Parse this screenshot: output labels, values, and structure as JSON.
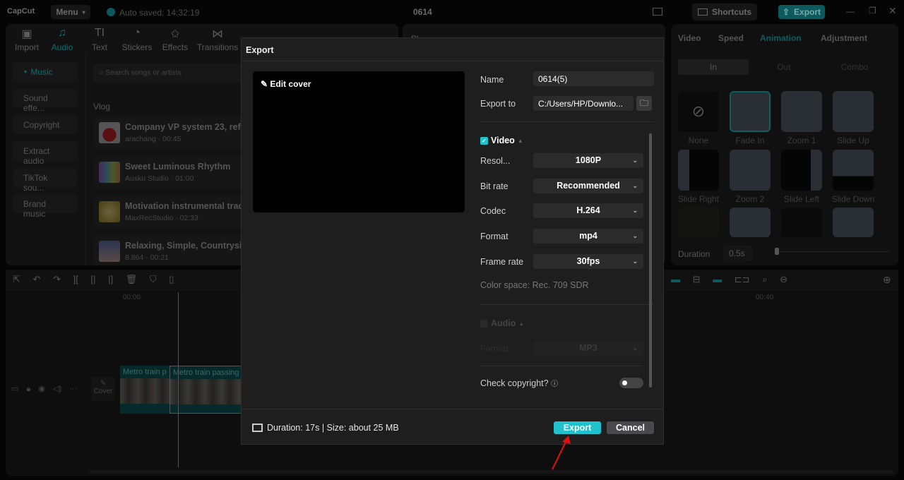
{
  "app": {
    "logo": "CapCut",
    "menu": "Menu",
    "autosave": "Auto saved: 14:32:19",
    "project_title": "0614",
    "shortcuts": "Shortcuts",
    "export": "Export"
  },
  "toolbar_tabs": [
    {
      "label": "Import",
      "icon": "import-icon"
    },
    {
      "label": "Audio",
      "icon": "audio-icon"
    },
    {
      "label": "Text",
      "icon": "text-icon"
    },
    {
      "label": "Stickers",
      "icon": "stickers-icon"
    },
    {
      "label": "Effects",
      "icon": "effects-icon"
    },
    {
      "label": "Transitions",
      "icon": "transitions-icon"
    }
  ],
  "audio_sidebar": [
    "Music",
    "Sound effe...",
    "Copyright",
    "Extract audio",
    "TikTok sou...",
    "Brand music"
  ],
  "search_placeholder": "Search songs or artists",
  "section": "Vlog",
  "songs": [
    {
      "title": "Company VP system 23, refr",
      "sub": "arachang · 00:45"
    },
    {
      "title": "Sweet Luminous Rhythm",
      "sub": "Ausku Studio · 01:00"
    },
    {
      "title": "Motivation instrumental trac",
      "sub": "MaxRecStudio · 02:33"
    },
    {
      "title": "Relaxing, Simple, Countrysid",
      "sub": "8.864 · 00:21"
    }
  ],
  "player_label": "Pl",
  "right_tabs": [
    "Video",
    "Speed",
    "Animation",
    "Adjustment"
  ],
  "anim_tabs": [
    "In",
    "Out",
    "Combo"
  ],
  "animations": [
    "None",
    "Fade In",
    "Zoom 1",
    "Slide Up",
    "Slide Right",
    "Zoom 2",
    "Slide Left",
    "Slide Down"
  ],
  "duration": {
    "label": "Duration",
    "value": "0.5s"
  },
  "timeline": {
    "t0": "00:00",
    "t40": "00:40",
    "cover": "Cover",
    "clip1": "Metro train p",
    "clip2": "Metro train passing"
  },
  "dialog": {
    "title": "Export",
    "edit_cover": "Edit cover",
    "name_label": "Name",
    "name_value": "0614(5)",
    "export_to_label": "Export to",
    "export_to_value": "C:/Users/HP/Downlo...",
    "video_label": "Video",
    "fields": [
      {
        "label": "Resol...",
        "value": "1080P"
      },
      {
        "label": "Bit rate",
        "value": "Recommended"
      },
      {
        "label": "Codec",
        "value": "H.264"
      },
      {
        "label": "Format",
        "value": "mp4"
      },
      {
        "label": "Frame rate",
        "value": "30fps"
      }
    ],
    "color_space": "Color space: Rec. 709 SDR",
    "audio_label": "Audio",
    "audio_format_label": "Format",
    "audio_format_value": "MP3",
    "copyright": "Check copyright?",
    "copyright_on": false,
    "summary": "Duration: 17s | Size: about 25 MB",
    "export_btn": "Export",
    "cancel_btn": "Cancel"
  },
  "colors": {
    "accent": "#1ec1cc",
    "annotation": "#e01010"
  }
}
